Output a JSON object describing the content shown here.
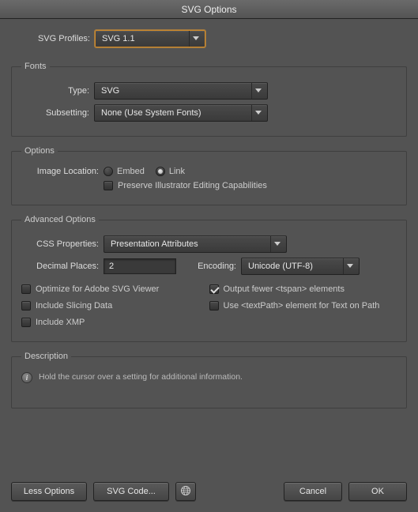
{
  "title": "SVG Options",
  "profiles": {
    "label": "SVG Profiles:",
    "value": "SVG 1.1"
  },
  "fonts": {
    "legend": "Fonts",
    "type": {
      "label": "Type:",
      "value": "SVG"
    },
    "subsetting": {
      "label": "Subsetting:",
      "value": "None (Use System Fonts)"
    }
  },
  "options": {
    "legend": "Options",
    "imageLocation": {
      "label": "Image Location:",
      "embed": "Embed",
      "link": "Link"
    },
    "preserve": "Preserve Illustrator Editing Capabilities"
  },
  "advanced": {
    "legend": "Advanced Options",
    "css": {
      "label": "CSS Properties:",
      "value": "Presentation Attributes"
    },
    "decimal": {
      "label": "Decimal Places:",
      "value": "2"
    },
    "encoding": {
      "label": "Encoding:",
      "value": "Unicode (UTF-8)"
    },
    "optimize": "Optimize for Adobe SVG Viewer",
    "outputFewer": "Output fewer <tspan> elements",
    "slicing": "Include Slicing Data",
    "textpath": "Use <textPath> element for Text on Path",
    "xmp": "Include XMP"
  },
  "description": {
    "legend": "Description",
    "text": "Hold the cursor over a setting for additional information."
  },
  "footer": {
    "lessOptions": "Less Options",
    "svgCode": "SVG Code...",
    "cancel": "Cancel",
    "ok": "OK"
  }
}
